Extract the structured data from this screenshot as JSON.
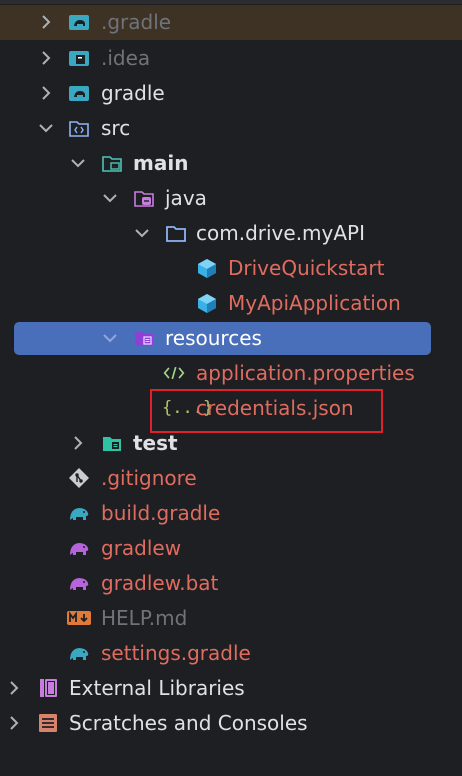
{
  "tree": {
    "gradle_dir": ".gradle",
    "idea_dir": ".idea",
    "gradle": "gradle",
    "src": "src",
    "main": "main",
    "java": "java",
    "package": "com.drive.myAPI",
    "class1": "DriveQuickstart",
    "class2": "MyApiApplication",
    "resources": "resources",
    "app_props": "application.properties",
    "credentials": "credentials.json",
    "test": "test",
    "gitignore": ".gitignore",
    "build_gradle": "build.gradle",
    "gradlew": "gradlew",
    "gradlew_bat": "gradlew.bat",
    "help": "HELP.md",
    "settings": "settings.gradle",
    "external": "External Libraries",
    "scratches": "Scratches and Consoles"
  },
  "icons": {
    "gradle": "gradle-elephant-icon",
    "folder": "folder-icon",
    "java_class": "java-class-icon",
    "json": "json-icon",
    "xml": "xml-tag-icon",
    "markdown": "markdown-icon",
    "library": "library-icon",
    "scratches": "scratches-icon"
  },
  "colors": {
    "selection": "#4a6fba",
    "highlight_box": "#e0202a",
    "modified_text": "#e06c60",
    "muted_text": "#6f737a"
  }
}
